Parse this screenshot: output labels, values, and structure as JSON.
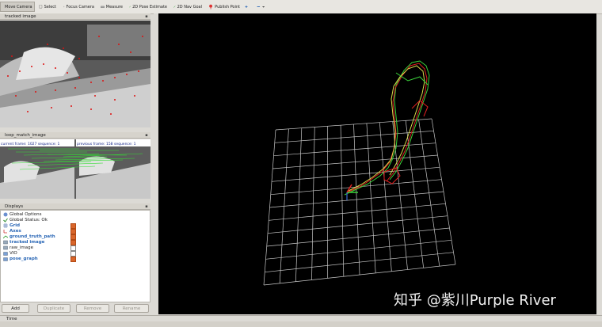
{
  "toolbar": {
    "tools": [
      {
        "label": "Move Camera",
        "icon": "move-camera-icon"
      },
      {
        "label": "Select",
        "icon": "select-icon"
      },
      {
        "label": "Focus Camera",
        "icon": "focus-camera-icon"
      },
      {
        "label": "Measure",
        "icon": "measure-icon"
      },
      {
        "label": "2D Pose Estimate",
        "icon": "pose-estimate-icon"
      },
      {
        "label": "2D Nav Goal",
        "icon": "nav-goal-icon"
      },
      {
        "label": "Publish Point",
        "icon": "publish-point-icon"
      }
    ]
  },
  "panels": {
    "tracked_image": {
      "title": "tracked image"
    },
    "loop_match_image": {
      "title": "loop_match_image",
      "current_frame": "current frame: 1027   sequence: 1",
      "previous_frame": "previous frame: 158   sequence: 1"
    }
  },
  "displays": {
    "title": "Displays",
    "items": [
      {
        "label": "Global Options",
        "icon": "globe-icon",
        "blue": false,
        "checkbox": null
      },
      {
        "label": "Global Status: Ok",
        "icon": "checkmark-icon",
        "blue": false,
        "checkbox": null
      },
      {
        "label": "Grid",
        "icon": "grid-icon",
        "blue": true,
        "checkbox": true
      },
      {
        "label": "Axes",
        "icon": "axes-icon",
        "blue": true,
        "checkbox": true
      },
      {
        "label": "ground_truth_path",
        "icon": "path-icon",
        "blue": true,
        "checkbox": true
      },
      {
        "label": "tracked image",
        "icon": "image-icon",
        "blue": true,
        "checkbox": true
      },
      {
        "label": "raw_image",
        "icon": "image-icon",
        "blue": false,
        "checkbox": false
      },
      {
        "label": "VIO",
        "icon": "folder-icon",
        "blue": false,
        "checkbox": false
      },
      {
        "label": "pose_graph",
        "icon": "folder-icon",
        "blue": true,
        "checkbox": true
      }
    ],
    "buttons": {
      "add": "Add",
      "duplicate": "Duplicate",
      "remove": "Remove",
      "rename": "Rename"
    }
  },
  "time_panel": {
    "title": "Time"
  },
  "watermark": "知乎 @紫川Purple River",
  "colors": {
    "viewport_bg": "#000000",
    "grid": "#c8c8c8",
    "path_green": "#3bd23b",
    "path_red": "#e02020",
    "path_yellow": "#d8d84a",
    "checkbox_on": "#d9662b",
    "link_blue": "#2a67b6"
  }
}
